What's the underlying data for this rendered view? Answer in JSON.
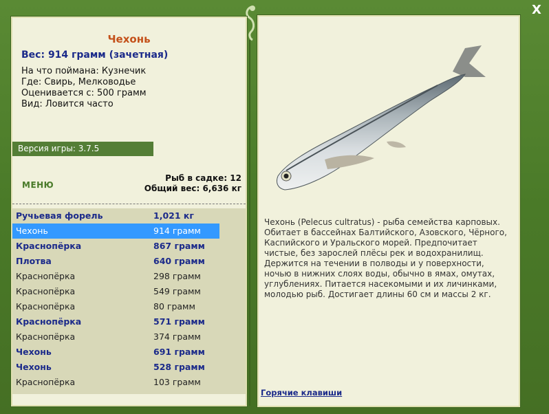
{
  "fish": {
    "name": "Чехонь",
    "weight_line": "Вес: 914 грамм (зачетная)",
    "caught_on": "На что поймана: Кузнечик",
    "where": "Где: Свирь, Мелководье",
    "valued": "Оценивается с: 500 грамм",
    "kind": "Вид: Ловится часто"
  },
  "version": "Версия игры: 3.7.5",
  "menu_label": "МЕНЮ",
  "stats": {
    "fish_count": "Рыб в садке: 12",
    "total_weight": "Общий вес: 6,636 кг"
  },
  "catch_list": [
    {
      "name": "Ручьевая форель",
      "weight": "1,021 кг",
      "style": "bold"
    },
    {
      "name": "Чехонь",
      "weight": "914 грамм",
      "style": "selected"
    },
    {
      "name": "Краснопёрка",
      "weight": "867 грамм",
      "style": "bold"
    },
    {
      "name": "Плотва",
      "weight": "640 грамм",
      "style": "bold"
    },
    {
      "name": "Краснопёрка",
      "weight": "298 грамм",
      "style": "normal"
    },
    {
      "name": "Краснопёрка",
      "weight": "549 грамм",
      "style": "normal"
    },
    {
      "name": "Краснопёрка",
      "weight": "80 грамм",
      "style": "normal"
    },
    {
      "name": "Краснопёрка",
      "weight": "571 грамм",
      "style": "bold"
    },
    {
      "name": "Краснопёрка",
      "weight": "374 грамм",
      "style": "normal"
    },
    {
      "name": "Чехонь",
      "weight": "691 грамм",
      "style": "bold"
    },
    {
      "name": "Чехонь",
      "weight": "528 грамм",
      "style": "bold"
    },
    {
      "name": "Краснопёрка",
      "weight": "103 грамм",
      "style": "normal"
    }
  ],
  "description": "Чехонь (Pelecus cultratus) - рыба семейства карповых. Обитает в бассейнах Балтийского, Азовского, Чёрного, Каспийского и Уральского морей. Предпочитает чистые, без зарослей плёсы рек и водохранилищ. Держится на течении в полводы и у поверхности, ночью в нижних слоях воды, обычно в ямах, омутах, углублениях. Питается насекомыми и их личинками, молодью рыб. Достигает длины 60 см и массы 2 кг.",
  "hotkeys_label": "Горячие клавиши",
  "close_label": "X",
  "colors": {
    "frame_green": "#4d7a2c",
    "panel_bg": "#f1f1dc",
    "title_orange": "#c4511a",
    "link_blue": "#1b2a8a",
    "selection_blue": "#3399ff",
    "version_bar": "#547e36"
  },
  "icons": {
    "close": "close-icon",
    "ornament": "dragon-ornament-icon",
    "fish_image": "chekhon-fish-image"
  }
}
